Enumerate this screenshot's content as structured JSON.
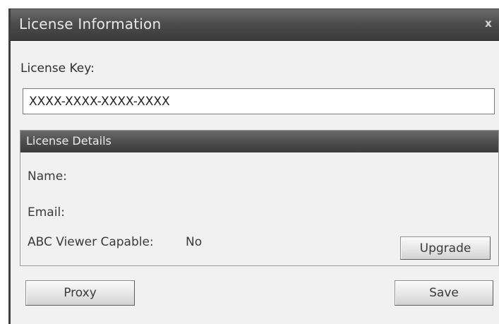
{
  "window": {
    "title": "License Information",
    "close_glyph": "x"
  },
  "license_key": {
    "label": "License Key:",
    "value": "XXXX-XXXX-XXXX-XXXX"
  },
  "details": {
    "header": "License Details",
    "name_label": "Name:",
    "name_value": "",
    "email_label": "Email:",
    "email_value": "",
    "abc_label": "ABC Viewer Capable:",
    "abc_value": "No",
    "upgrade_label": "Upgrade"
  },
  "footer": {
    "proxy_label": "Proxy",
    "save_label": "Save"
  },
  "colors": {
    "titlebar": "#4d4d4d",
    "dialog_bg": "#f1f1f1"
  }
}
